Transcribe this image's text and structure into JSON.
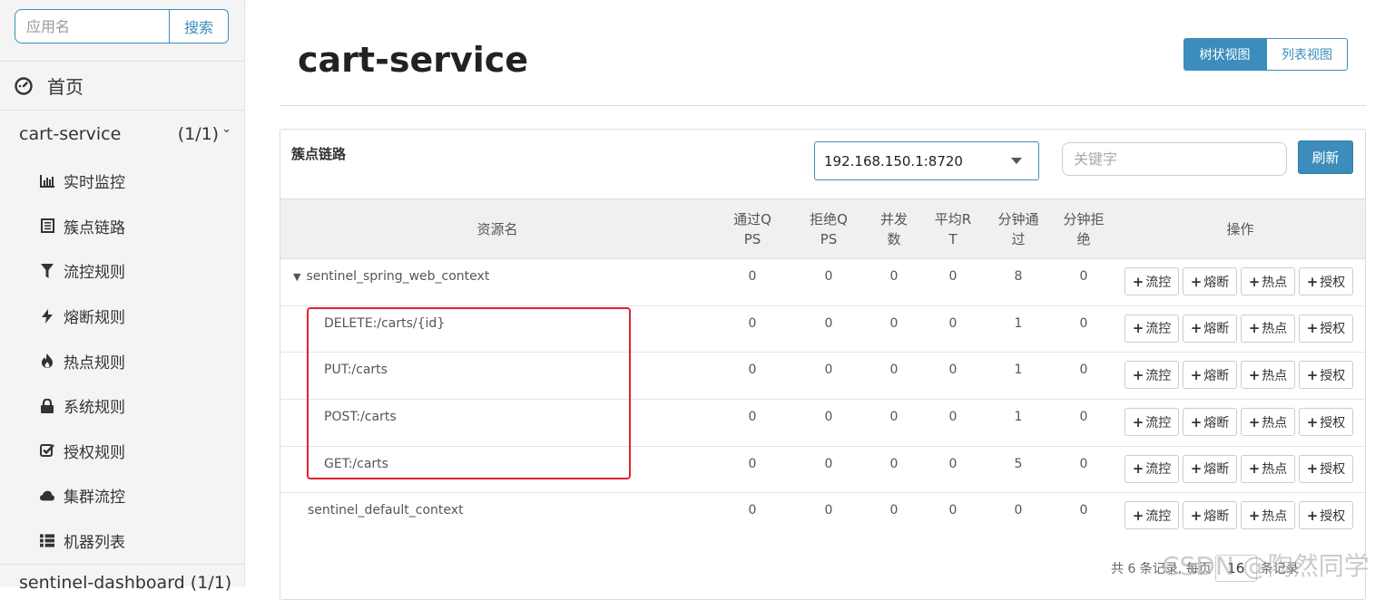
{
  "sidebar": {
    "search": {
      "placeholder": "应用名",
      "button_label": "搜索"
    },
    "home_label": "首页",
    "app": {
      "name": "cart-service",
      "count": "(1/1)"
    },
    "menu": [
      {
        "label": "实时监控",
        "icon": "bar-chart-icon"
      },
      {
        "label": "簇点链路",
        "icon": "list-alt-icon"
      },
      {
        "label": "流控规则",
        "icon": "filter-icon"
      },
      {
        "label": "熔断规则",
        "icon": "flash-icon"
      },
      {
        "label": "热点规则",
        "icon": "fire-icon"
      },
      {
        "label": "系统规则",
        "icon": "lock-icon"
      },
      {
        "label": "授权规则",
        "icon": "check-icon"
      },
      {
        "label": "集群流控",
        "icon": "cloud-icon"
      },
      {
        "label": "机器列表",
        "icon": "th-list-icon"
      }
    ],
    "app2": {
      "name": "sentinel-dashboard",
      "count": "(1/1)"
    }
  },
  "main": {
    "title": "cart-service",
    "view_toggle": {
      "tree": "树状视图",
      "list": "列表视图"
    },
    "panel_title": "簇点链路",
    "machine": "192.168.150.1:8720",
    "keyword_placeholder": "关键字",
    "refresh_label": "刷新",
    "columns": {
      "resource": "资源名",
      "pass_qps": "通过QPS",
      "block_qps": "拒绝QPS",
      "threads": "并发数",
      "avg_rt": "平均RT",
      "pass_min": "分钟通过",
      "block_min": "分钟拒绝",
      "ops": "操作"
    },
    "op_labels": {
      "flow": "流控",
      "degrade": "熔断",
      "hot": "热点",
      "auth": "授权"
    },
    "rows": [
      {
        "resource": "sentinel_spring_web_context",
        "pass_qps": "0",
        "block_qps": "0",
        "threads": "0",
        "avg_rt": "0",
        "pass_min": "8",
        "block_min": "0"
      },
      {
        "resource": "DELETE:/carts/{id}",
        "pass_qps": "0",
        "block_qps": "0",
        "threads": "0",
        "avg_rt": "0",
        "pass_min": "1",
        "block_min": "0"
      },
      {
        "resource": "PUT:/carts",
        "pass_qps": "0",
        "block_qps": "0",
        "threads": "0",
        "avg_rt": "0",
        "pass_min": "1",
        "block_min": "0"
      },
      {
        "resource": "POST:/carts",
        "pass_qps": "0",
        "block_qps": "0",
        "threads": "0",
        "avg_rt": "0",
        "pass_min": "1",
        "block_min": "0"
      },
      {
        "resource": "GET:/carts",
        "pass_qps": "0",
        "block_qps": "0",
        "threads": "0",
        "avg_rt": "0",
        "pass_min": "5",
        "block_min": "0"
      },
      {
        "resource": "sentinel_default_context",
        "pass_qps": "0",
        "block_qps": "0",
        "threads": "0",
        "avg_rt": "0",
        "pass_min": "0",
        "block_min": "0"
      }
    ],
    "pagination": {
      "prefix": "共 6 条记录, 每页",
      "page_size": "16",
      "suffix": "条记录"
    }
  },
  "watermark": "CSDN @陶然同学",
  "colors": {
    "primary": "#3c8dbc",
    "highlight": "#d9262c"
  }
}
